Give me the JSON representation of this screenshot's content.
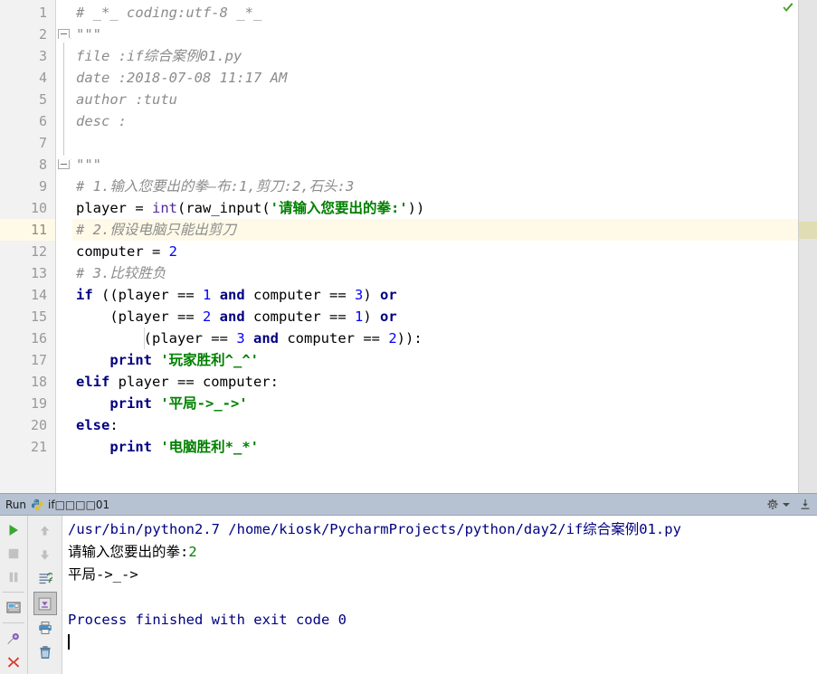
{
  "editor": {
    "gutter_lines": [
      "1",
      "2",
      "3",
      "4",
      "5",
      "6",
      "7",
      "8",
      "9",
      "10",
      "11",
      "12",
      "13",
      "14",
      "15",
      "16",
      "17",
      "18",
      "19",
      "20",
      "21"
    ],
    "current_line": 11,
    "lines": [
      {
        "n": "1",
        "segments": [
          {
            "cls": "cmt",
            "t": "# _*_ coding:utf-8 _*_"
          }
        ]
      },
      {
        "n": "2",
        "segments": [
          {
            "cls": "cmt",
            "t": "\"\"\""
          }
        ]
      },
      {
        "n": "3",
        "segments": [
          {
            "cls": "cmt",
            "t": "file :if综合案例01.py"
          }
        ]
      },
      {
        "n": "4",
        "segments": [
          {
            "cls": "cmt",
            "t": "date :2018-07-08 11:17 AM"
          }
        ]
      },
      {
        "n": "5",
        "segments": [
          {
            "cls": "cmt",
            "t": "author :tutu"
          }
        ]
      },
      {
        "n": "6",
        "segments": [
          {
            "cls": "cmt",
            "t": "desc :"
          }
        ]
      },
      {
        "n": "7",
        "segments": [
          {
            "cls": "cmt",
            "t": ""
          }
        ]
      },
      {
        "n": "8",
        "segments": [
          {
            "cls": "cmt",
            "t": "\"\"\""
          }
        ]
      },
      {
        "n": "9",
        "segments": [
          {
            "cls": "cmt",
            "t": "# 1.输入您要出的拳—布:1,剪刀:2,石头:3"
          }
        ]
      },
      {
        "n": "10",
        "segments": [
          {
            "cls": "plain",
            "t": "player = "
          },
          {
            "cls": "bi",
            "t": "int"
          },
          {
            "cls": "plain",
            "t": "(raw_input("
          },
          {
            "cls": "str",
            "t": "'请输入您要出的拳:'"
          },
          {
            "cls": "plain",
            "t": "))"
          }
        ]
      },
      {
        "n": "11",
        "segments": [
          {
            "cls": "cmt",
            "t": "# 2.假设电脑只能出剪刀"
          }
        ]
      },
      {
        "n": "12",
        "segments": [
          {
            "cls": "plain",
            "t": "computer = "
          },
          {
            "cls": "num",
            "t": "2"
          }
        ]
      },
      {
        "n": "13",
        "segments": [
          {
            "cls": "cmt",
            "t": "# 3.比较胜负"
          }
        ]
      },
      {
        "n": "14",
        "segments": [
          {
            "cls": "kw",
            "t": "if"
          },
          {
            "cls": "plain",
            "t": " ((player == "
          },
          {
            "cls": "num",
            "t": "1"
          },
          {
            "cls": "plain",
            "t": " "
          },
          {
            "cls": "kw",
            "t": "and"
          },
          {
            "cls": "plain",
            "t": " computer == "
          },
          {
            "cls": "num",
            "t": "3"
          },
          {
            "cls": "plain",
            "t": ") "
          },
          {
            "cls": "kw",
            "t": "or"
          }
        ]
      },
      {
        "n": "15",
        "segments": [
          {
            "cls": "plain",
            "t": "    (player == "
          },
          {
            "cls": "num",
            "t": "2"
          },
          {
            "cls": "plain",
            "t": " "
          },
          {
            "cls": "kw",
            "t": "and"
          },
          {
            "cls": "plain",
            "t": " computer == "
          },
          {
            "cls": "num",
            "t": "1"
          },
          {
            "cls": "plain",
            "t": ") "
          },
          {
            "cls": "kw",
            "t": "or"
          }
        ]
      },
      {
        "n": "16",
        "segments": [
          {
            "cls": "plain",
            "t": "        (player == "
          },
          {
            "cls": "num",
            "t": "3"
          },
          {
            "cls": "plain",
            "t": " "
          },
          {
            "cls": "kw",
            "t": "and"
          },
          {
            "cls": "plain",
            "t": " computer == "
          },
          {
            "cls": "num",
            "t": "2"
          },
          {
            "cls": "plain",
            "t": ")):"
          }
        ]
      },
      {
        "n": "17",
        "segments": [
          {
            "cls": "plain",
            "t": "    "
          },
          {
            "cls": "kw",
            "t": "print"
          },
          {
            "cls": "plain",
            "t": " "
          },
          {
            "cls": "str",
            "t": "'玩家胜利^_^'"
          }
        ]
      },
      {
        "n": "18",
        "segments": [
          {
            "cls": "kw",
            "t": "elif"
          },
          {
            "cls": "plain",
            "t": " player == computer:"
          }
        ]
      },
      {
        "n": "19",
        "segments": [
          {
            "cls": "plain",
            "t": "    "
          },
          {
            "cls": "kw",
            "t": "print"
          },
          {
            "cls": "plain",
            "t": " "
          },
          {
            "cls": "str",
            "t": "'平局->_->'"
          }
        ]
      },
      {
        "n": "20",
        "segments": [
          {
            "cls": "kw",
            "t": "else"
          },
          {
            "cls": "plain",
            "t": ":"
          }
        ]
      },
      {
        "n": "21",
        "segments": [
          {
            "cls": "plain",
            "t": "    "
          },
          {
            "cls": "kw",
            "t": "print"
          },
          {
            "cls": "plain",
            "t": " "
          },
          {
            "cls": "str",
            "t": "'电脑胜利*_*'"
          }
        ]
      }
    ],
    "fold_markers": [
      {
        "line": 2,
        "dir": "down"
      },
      {
        "line": 8,
        "dir": "up"
      }
    ],
    "inspection_status_icon": "green-check-icon"
  },
  "run_window": {
    "label": "Run",
    "tab_icon": "python-file-icon",
    "tab_name": "if□□□□01",
    "settings_icon": "gear-icon",
    "settings_dropdown_icon": "chevron-down-icon",
    "hide_icon": "hide-window-icon",
    "toolbar_left": [
      {
        "name": "rerun-button",
        "icon": "green-play-triangle-icon",
        "state": "enabled"
      },
      {
        "name": "stop-button",
        "icon": "stop-square-icon",
        "state": "disabled"
      },
      {
        "name": "pause-button",
        "icon": "pause-bars-icon",
        "state": "disabled"
      },
      {
        "name": "show-console-button",
        "icon": "console-window-icon",
        "state": "enabled"
      },
      {
        "name": "pin-tab-button",
        "icon": "pushpin-icon",
        "state": "enabled"
      },
      {
        "name": "close-tab-button",
        "icon": "red-x-close-icon",
        "state": "enabled"
      }
    ],
    "toolbar_right": [
      {
        "name": "up-stack-trace-button",
        "icon": "arrow-up-icon",
        "state": "disabled"
      },
      {
        "name": "down-stack-trace-button",
        "icon": "arrow-down-icon",
        "state": "disabled"
      },
      {
        "name": "soft-wrap-button",
        "icon": "soft-wrap-icon",
        "state": "enabled"
      },
      {
        "name": "scroll-to-end-button",
        "icon": "scroll-to-end-icon",
        "state": "pressed"
      },
      {
        "name": "print-button",
        "icon": "printer-icon",
        "state": "enabled"
      },
      {
        "name": "clear-all-button",
        "icon": "trash-icon",
        "state": "enabled"
      }
    ],
    "console_output": [
      {
        "segments": [
          {
            "cls": "out-cmd",
            "t": "/usr/bin/python2.7 /home/kiosk/PycharmProjects/python/day2/if综合案例01.py"
          }
        ]
      },
      {
        "segments": [
          {
            "cls": "plain",
            "t": "请输入您要出的拳:"
          },
          {
            "cls": "out-green",
            "t": "2"
          }
        ]
      },
      {
        "segments": [
          {
            "cls": "plain",
            "t": "平局->_->"
          }
        ]
      },
      {
        "segments": [
          {
            "cls": "plain",
            "t": ""
          }
        ]
      },
      {
        "segments": [
          {
            "cls": "out-cmd",
            "t": "Process finished with exit code 0"
          }
        ]
      }
    ],
    "caret_visible": true
  },
  "colors": {
    "editor_bg": "#ffffff",
    "gutter_bg": "#f2f2f2",
    "caret_row": "#fffae8",
    "comment": "#8c8c8c",
    "keyword": "#000080",
    "number": "#0000ff",
    "string": "#008000",
    "builtin": "#5028a0",
    "run_header_bg": "#b6c2d2",
    "console_cmd": "#000080",
    "accent_green": "#4a9d2f",
    "accent_red": "#d03b2f",
    "accent_purple": "#7d5ba6"
  }
}
